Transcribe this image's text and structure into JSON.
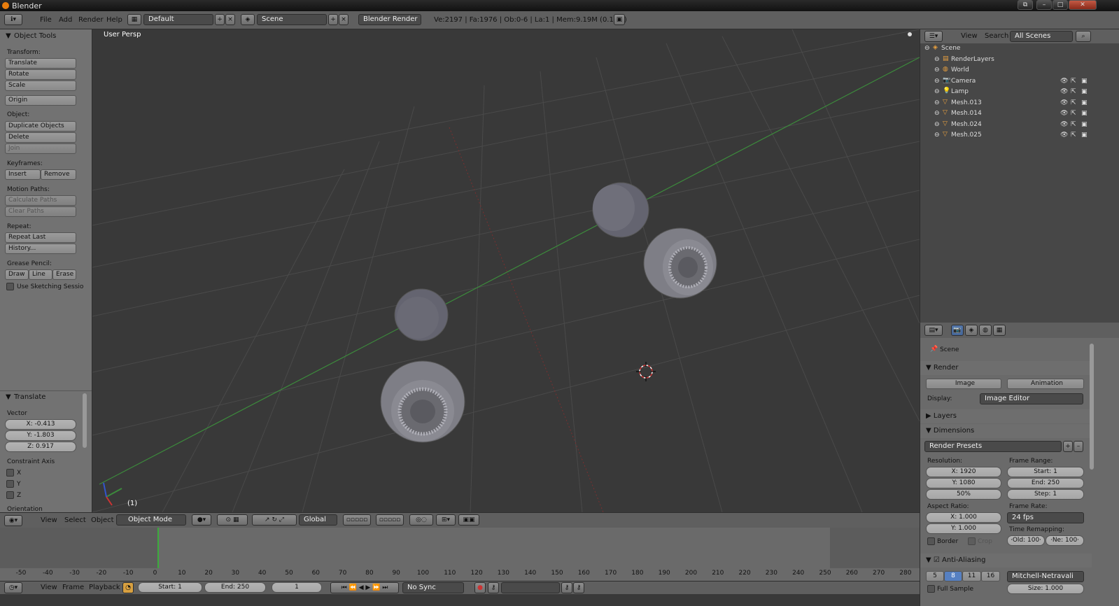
{
  "window": {
    "title": "Blender",
    "min": "–",
    "max": "□",
    "close": "✕"
  },
  "menubar": {
    "items": [
      "File",
      "Add",
      "Render",
      "Help"
    ],
    "layout": "Default",
    "scene": "Scene",
    "engine": "Blender Render",
    "stats": "Ve:2197 | Fa:1976 | Ob:0-6 | La:1 | Mem:9.19M (0.10M)"
  },
  "toolshelf": {
    "title": "Object Tools",
    "transform_label": "Transform:",
    "translate": "Translate",
    "rotate": "Rotate",
    "scale": "Scale",
    "origin": "Origin",
    "object_label": "Object:",
    "duplicate": "Duplicate Objects",
    "delete": "Delete",
    "join": "Join",
    "keyframes_label": "Keyframes:",
    "insert": "Insert",
    "remove": "Remove",
    "motion_label": "Motion Paths:",
    "calc_paths": "Calculate Paths",
    "clear_paths": "Clear Paths",
    "repeat_label": "Repeat:",
    "repeat_last": "Repeat Last",
    "history": "History...",
    "grease_label": "Grease Pencil:",
    "draw": "Draw",
    "line": "Line",
    "erase": "Erase",
    "sketch": "Use Sketching Sessio"
  },
  "operator": {
    "title": "Translate",
    "vector_label": "Vector",
    "x": "X: -0.413",
    "y": "Y: -1.803",
    "z": "Z: 0.917",
    "constraint_label": "Constraint Axis",
    "cx": "X",
    "cy": "Y",
    "cz": "Z",
    "orientation": "Orientation"
  },
  "viewport": {
    "view_name": "User Persp",
    "frame_indicator": "(1)"
  },
  "viewport_header": {
    "view": "View",
    "select": "Select",
    "object": "Object",
    "mode": "Object Mode",
    "orientation": "Global"
  },
  "timeline": {
    "ticks": [
      "-50",
      "-40",
      "-30",
      "-20",
      "-10",
      "0",
      "10",
      "20",
      "30",
      "40",
      "50",
      "60",
      "70",
      "80",
      "90",
      "100",
      "110",
      "120",
      "130",
      "140",
      "150",
      "160",
      "170",
      "180",
      "190",
      "200",
      "210",
      "220",
      "230",
      "240",
      "250",
      "260",
      "270",
      "280"
    ],
    "current_frame": 1
  },
  "timeline_header": {
    "view": "View",
    "frame": "Frame",
    "playback": "Playback",
    "start": "Start: 1",
    "end": "End: 250",
    "current": "1",
    "sync": "No Sync"
  },
  "outliner": {
    "view": "View",
    "search": "Search",
    "scope": "All Scenes",
    "items": [
      {
        "name": "Scene",
        "indent": 0
      },
      {
        "name": "RenderLayers",
        "indent": 1
      },
      {
        "name": "World",
        "indent": 1
      },
      {
        "name": "Camera",
        "indent": 1
      },
      {
        "name": "Lamp",
        "indent": 1
      },
      {
        "name": "Mesh.013",
        "indent": 1
      },
      {
        "name": "Mesh.014",
        "indent": 1
      },
      {
        "name": "Mesh.024",
        "indent": 1
      },
      {
        "name": "Mesh.025",
        "indent": 1
      }
    ]
  },
  "properties": {
    "context": "Scene",
    "render_panel": "Render",
    "image": "Image",
    "animation": "Animation",
    "display_label": "Display:",
    "display": "Image Editor",
    "layers": "Layers",
    "dimensions": "Dimensions",
    "presets": "Render Presets",
    "resolution_label": "Resolution:",
    "res_x": "X: 1920",
    "res_y": "Y: 1080",
    "res_pct": "50%",
    "frame_range_label": "Frame Range:",
    "start": "Start: 1",
    "end": "End: 250",
    "step": "Step: 1",
    "aspect_label": "Aspect Ratio:",
    "asp_x": "X: 1.000",
    "asp_y": "Y: 1.000",
    "frame_rate_label": "Frame Rate:",
    "fps": "24 fps",
    "remap_label": "Time Remapping:",
    "old": "·Old: 100·",
    "new": "·Ne: 100·",
    "border": "Border",
    "crop": "Crop",
    "aa": "Anti-Aliasing",
    "aa5": "5",
    "aa8": "8",
    "aa11": "11",
    "aa16": "16",
    "filter": "Mitchell-Netravali",
    "full_sample": "Full Sample",
    "size": "Size: 1.000"
  }
}
